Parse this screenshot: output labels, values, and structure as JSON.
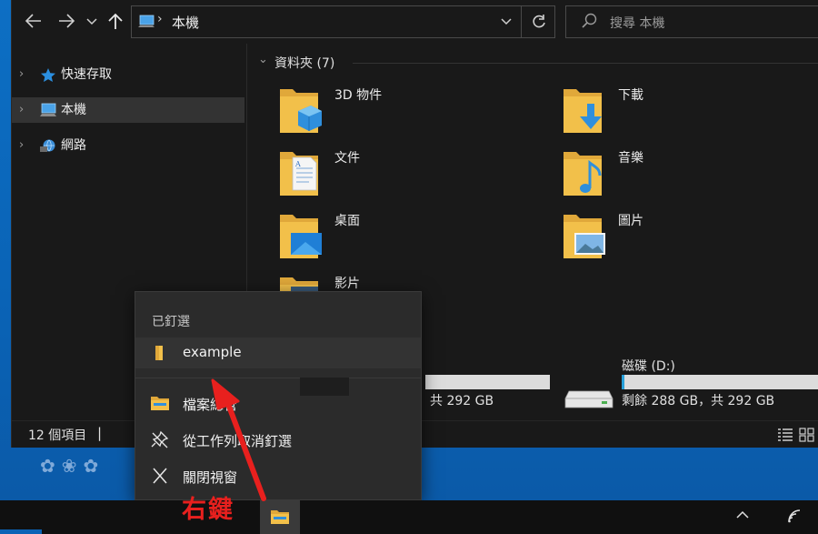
{
  "address": {
    "path_label": "本機",
    "search_placeholder": "搜尋 本機"
  },
  "nav": {
    "items": [
      {
        "label": "快速存取",
        "icon": "star-icon"
      },
      {
        "label": "本機",
        "icon": "computer-icon"
      },
      {
        "label": "網路",
        "icon": "network-icon"
      }
    ]
  },
  "content": {
    "group_title": "資料夾 (7)",
    "folders": [
      {
        "label": "3D 物件",
        "icon": "3d-objects-folder-icon"
      },
      {
        "label": "下載",
        "icon": "downloads-folder-icon"
      },
      {
        "label": "文件",
        "icon": "documents-folder-icon"
      },
      {
        "label": "音樂",
        "icon": "music-folder-icon"
      },
      {
        "label": "桌面",
        "icon": "desktop-folder-icon"
      },
      {
        "label": "圖片",
        "icon": "pictures-folder-icon"
      },
      {
        "label": "影片",
        "icon": "videos-folder-icon"
      }
    ],
    "drive_c": {
      "text": "共 292 GB"
    },
    "drive_d": {
      "title": "磁碟 (D:)",
      "text": "剩餘 288 GB，共 292 GB",
      "used_fraction": 0.01
    }
  },
  "status": {
    "count": "12 個項目",
    "separator": "|"
  },
  "jumplist": {
    "header": "已釘選",
    "pinned": [
      {
        "label": "example"
      }
    ],
    "actions": [
      {
        "label": "檔案總管"
      },
      {
        "label": "從工作列取消釘選"
      },
      {
        "label": "關閉視窗"
      }
    ]
  },
  "annotation": {
    "text": "右鍵"
  },
  "colors": {
    "accent": "#26a0da",
    "folder": "#f2c04a",
    "annotation": "#e8201e",
    "desktop": "#0a63b6"
  }
}
